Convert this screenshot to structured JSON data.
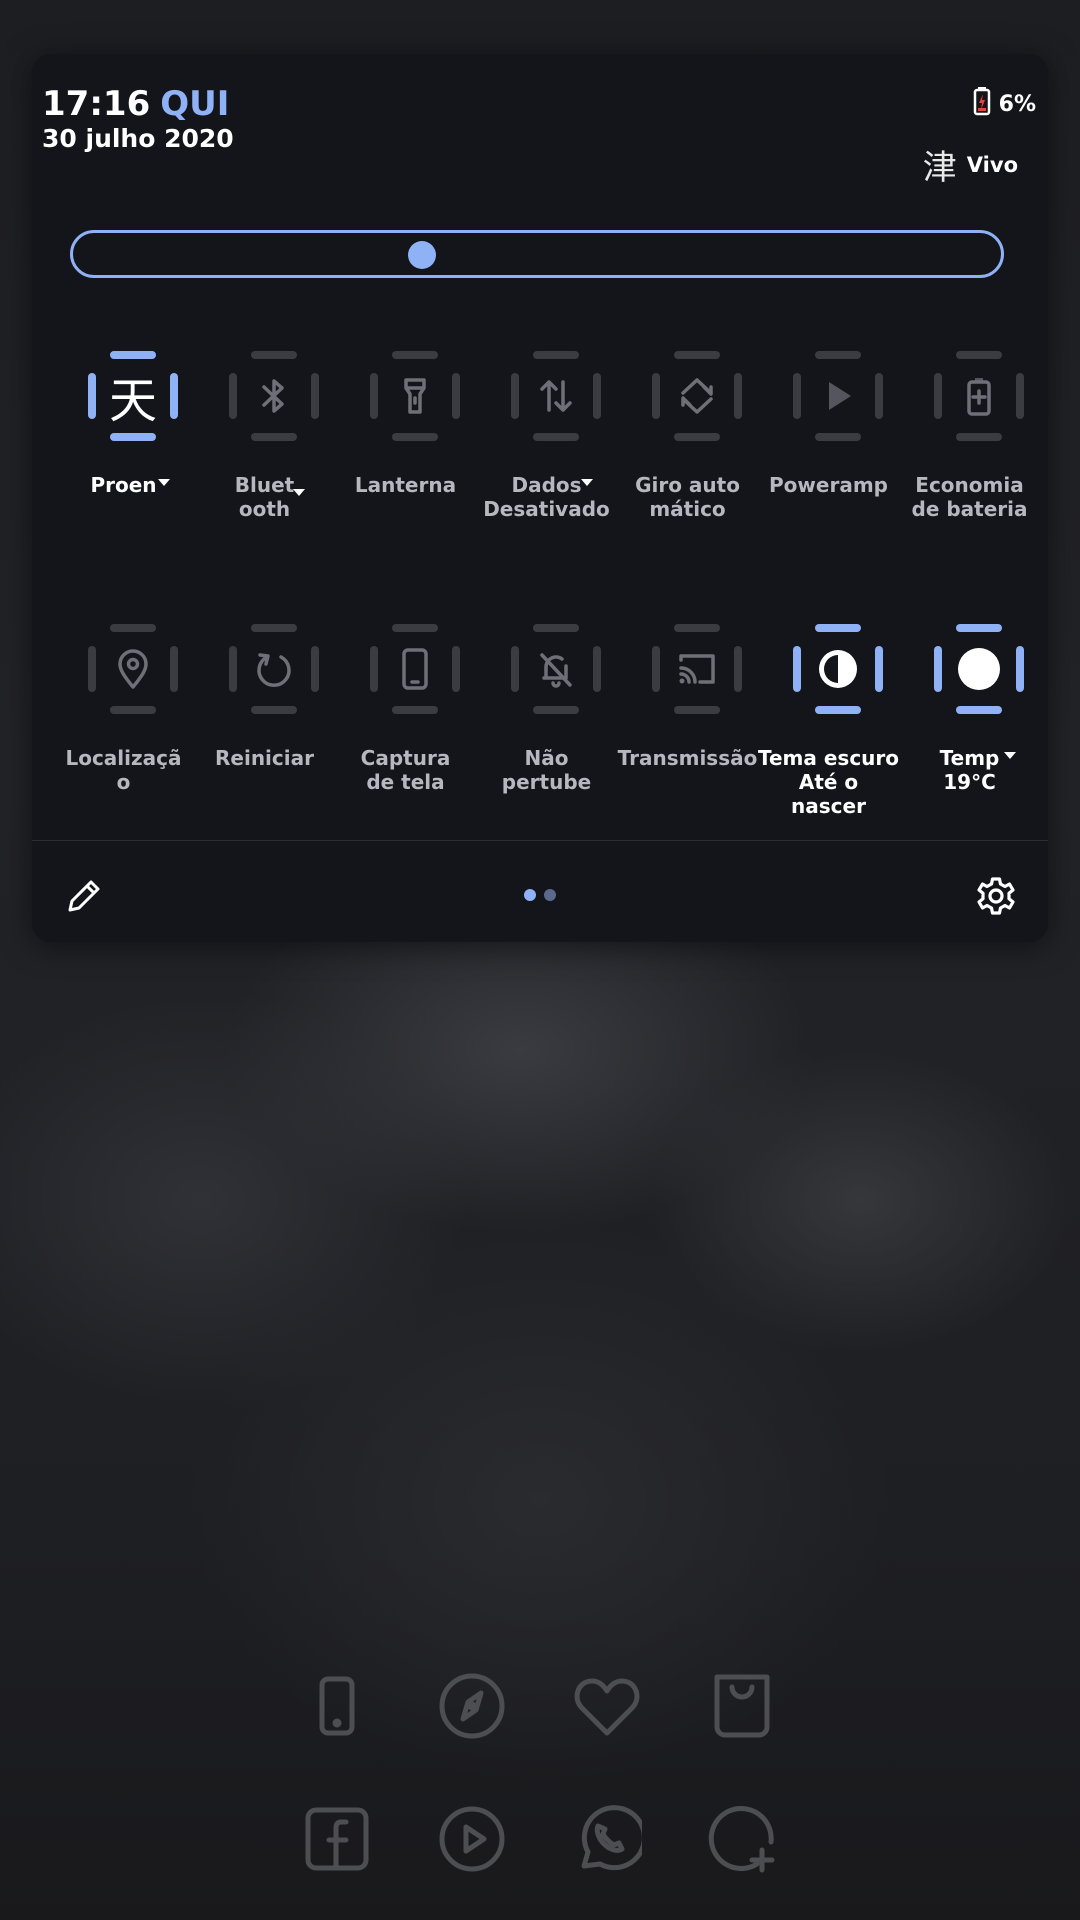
{
  "status": {
    "time": "17:16",
    "day": "QUI",
    "date": "30 julho 2020",
    "battery_percent": "6%",
    "carrier_glyph": "津",
    "carrier": "Vivo"
  },
  "brightness": {
    "level": 0.37
  },
  "tiles": [
    {
      "id": "weather-kanji",
      "glyph": "天",
      "label": "Proen",
      "on": true,
      "caret": true
    },
    {
      "id": "bluetooth",
      "icon": "bluetooth-icon",
      "label": "Bluet\nooth",
      "on": false,
      "caret": true
    },
    {
      "id": "flashlight",
      "icon": "flashlight-icon",
      "label": "Lanterna",
      "on": false,
      "caret": false
    },
    {
      "id": "mobile-data",
      "icon": "data-arrows-icon",
      "label": "Dados\nDesativado",
      "on": false,
      "caret": true
    },
    {
      "id": "auto-rotate",
      "icon": "rotate-icon",
      "label": "Giro auto\nmático",
      "on": false,
      "caret": false
    },
    {
      "id": "poweramp",
      "icon": "play-icon",
      "label": "Poweramp",
      "on": false,
      "caret": false
    },
    {
      "id": "battery-saver",
      "icon": "battery-plus-icon",
      "label": "Economia\nde bateria",
      "on": false,
      "caret": false
    },
    {
      "id": "location",
      "icon": "location-pin-icon",
      "label": "Localizaçã\no",
      "on": false,
      "caret": false
    },
    {
      "id": "restart",
      "icon": "restart-icon",
      "label": "Reiniciar",
      "on": false,
      "caret": false
    },
    {
      "id": "screenshot",
      "icon": "phone-icon",
      "label": "Captura\nde tela",
      "on": false,
      "caret": false
    },
    {
      "id": "dnd",
      "icon": "bell-off-icon",
      "label": "Não\npertube",
      "on": false,
      "caret": false
    },
    {
      "id": "cast",
      "icon": "cast-icon",
      "label": "Transmissão",
      "on": false,
      "caret": false
    },
    {
      "id": "dark-theme",
      "icon": "contrast-icon",
      "label": "Tema escuro\nAté o nascer",
      "on": true,
      "caret": false
    },
    {
      "id": "temperature",
      "icon": "circle-icon",
      "label": "Temp\n19°C",
      "on": true,
      "caret": true
    }
  ],
  "footer": {
    "page": 1,
    "pages": 2
  },
  "dock": [
    [
      "phone-outline-icon",
      "compass-icon",
      "heart-icon",
      "shopping-bag-icon"
    ],
    [
      "facebook-icon",
      "play-circle-icon",
      "whatsapp-icon",
      "add-circle-icon"
    ]
  ],
  "colors": {
    "accent": "#8fb1f5",
    "panel": "#14141b",
    "inactive": "#3b3b42",
    "dock_icon": "#4d4e52"
  }
}
